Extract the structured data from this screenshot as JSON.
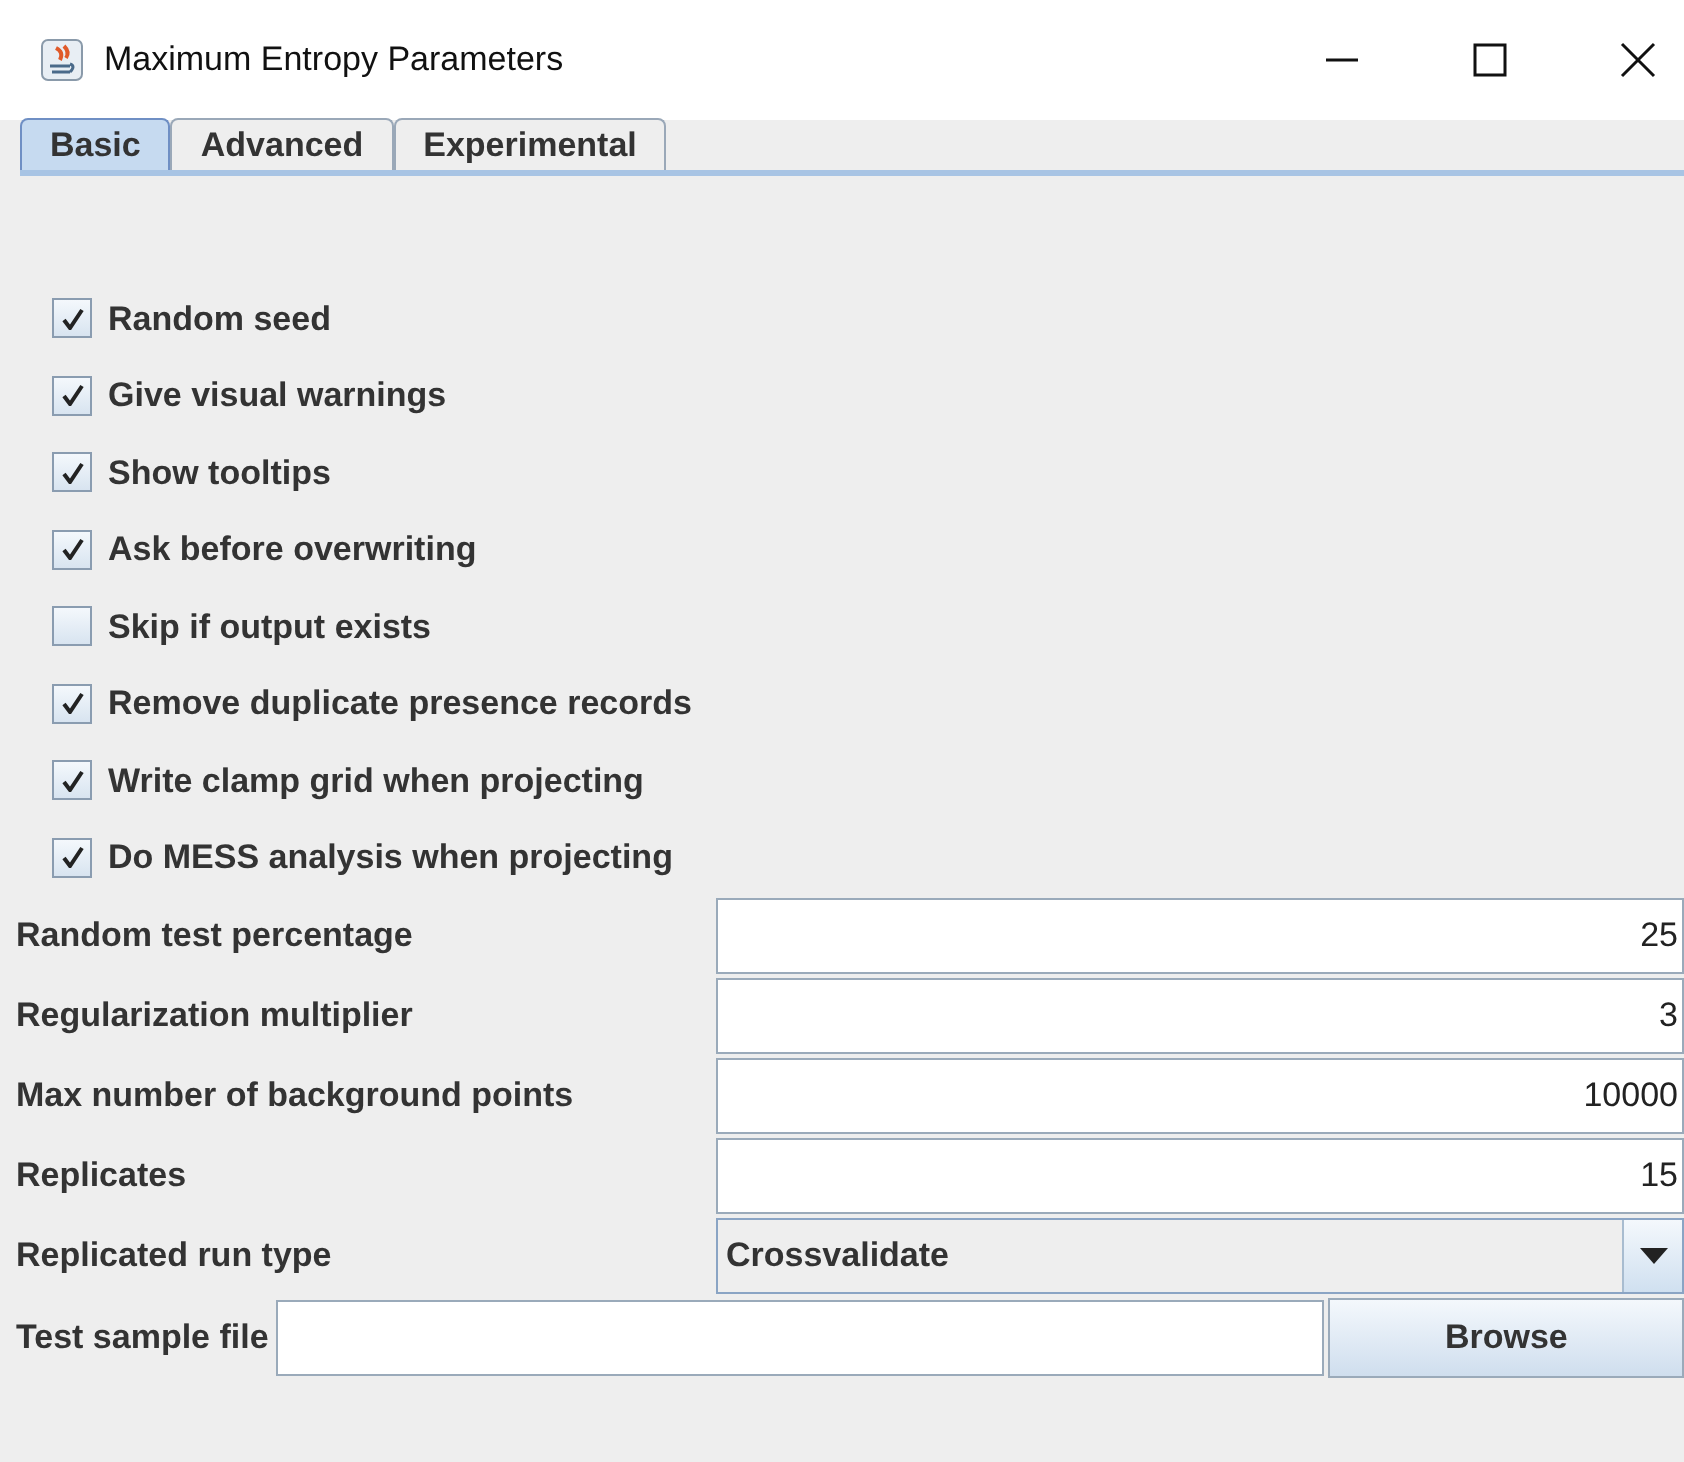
{
  "window": {
    "title": "Maximum Entropy Parameters"
  },
  "tabs": [
    {
      "label": "Basic",
      "selected": true
    },
    {
      "label": "Advanced",
      "selected": false
    },
    {
      "label": "Experimental",
      "selected": false
    }
  ],
  "checkboxes": [
    {
      "label": "Random seed",
      "checked": true
    },
    {
      "label": "Give visual warnings",
      "checked": true
    },
    {
      "label": "Show tooltips",
      "checked": true
    },
    {
      "label": "Ask before overwriting",
      "checked": true
    },
    {
      "label": "Skip if output exists",
      "checked": false
    },
    {
      "label": "Remove duplicate presence records",
      "checked": true
    },
    {
      "label": "Write clamp grid when projecting",
      "checked": true
    },
    {
      "label": "Do MESS analysis when projecting",
      "checked": true
    }
  ],
  "fields": [
    {
      "kind": "text",
      "label": "Random test percentage",
      "value": "25"
    },
    {
      "kind": "text",
      "label": "Regularization multiplier",
      "value": "3"
    },
    {
      "kind": "text",
      "label": "Max number of background points",
      "value": "10000"
    },
    {
      "kind": "text",
      "label": "Replicates",
      "value": "15"
    },
    {
      "kind": "dropdown",
      "label": "Replicated run type",
      "value": "Crossvalidate"
    }
  ],
  "test_sample": {
    "label": "Test sample file",
    "button": "Browse"
  }
}
